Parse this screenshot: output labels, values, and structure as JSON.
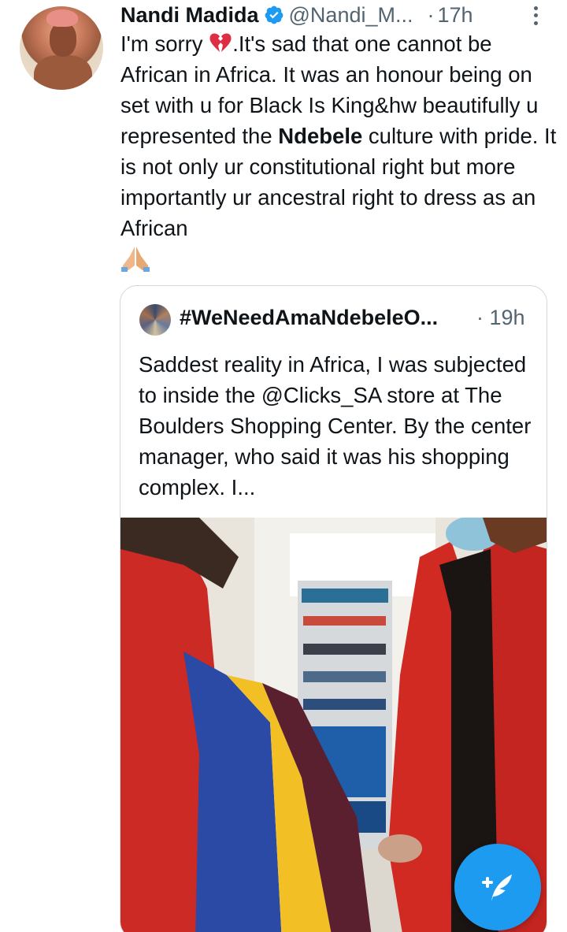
{
  "tweet": {
    "author_name": "Nandi Madida",
    "handle": "@Nandi_M...",
    "separator": "·",
    "time": "17h",
    "text_parts": {
      "p1": "I'm sorry ",
      "p2": ".It's sad that one cannot be African in Africa. It was an honour being on set with u for Black Is King&hw beautifully u represented the ",
      "bold": "Ndebele",
      "p3": " culture with pride. It is not only ur constitutional right but more importantly ur ancestral right to dress as an African"
    },
    "icons": {
      "broken_heart": "broken-heart-icon",
      "praying_hands": "praying-hands-icon",
      "verified": "verified-badge-icon",
      "more": "more-options-icon"
    }
  },
  "quoted_tweet": {
    "author_name": "#WeNeedAmaNdebeleO...",
    "separator": "·",
    "time": "19h",
    "text": "Saddest reality in Africa, I was subjected to inside the @Clicks_SA store at The Boulders Shopping Center. By the center manager, who said it was his shopping complex. I...",
    "media": "video-thumbnail"
  },
  "compose_button": {
    "icon": "compose-feather-icon",
    "color": "#1d9bf0"
  },
  "colors": {
    "text_primary": "#0f1419",
    "text_secondary": "#536471",
    "accent": "#1d9bf0",
    "border": "#cfd9de"
  }
}
